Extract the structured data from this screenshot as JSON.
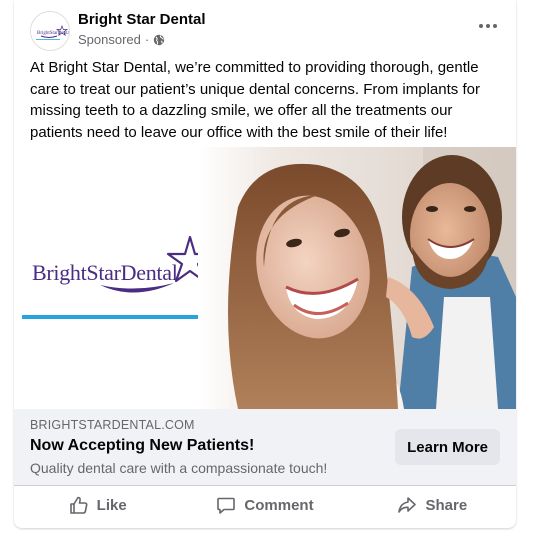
{
  "post": {
    "page_name": "Bright Star Dental",
    "sponsored_label": "Sponsored",
    "meta_separator": "·",
    "privacy_icon": "globe-icon",
    "more_icon": "more-options-icon",
    "avatar_logo_text": "BrightStarDental",
    "body_text": "At Bright Star Dental, we’re committed to providing thorough, gentle care to treat our patient’s unique dental concerns. From implants for missing teeth to a dazzling smile, we offer all the treatments our patients need to leave our office with the best smile of their life!"
  },
  "creative": {
    "logo_text": "BrightStarDental",
    "logo_color": "#4a2c82",
    "accent_line_color": "#25a4dd",
    "photo_description_icon": "smiling-couple-photo"
  },
  "cta": {
    "domain": "BRIGHTSTARDENTAL.COM",
    "headline": "Now Accepting New Patients!",
    "description": "Quality dental care with a compassionate touch!",
    "button_label": "Learn More"
  },
  "actions": [
    {
      "label": "Like",
      "icon": "thumbs-up-icon"
    },
    {
      "label": "Comment",
      "icon": "comment-icon"
    },
    {
      "label": "Share",
      "icon": "share-icon"
    }
  ]
}
